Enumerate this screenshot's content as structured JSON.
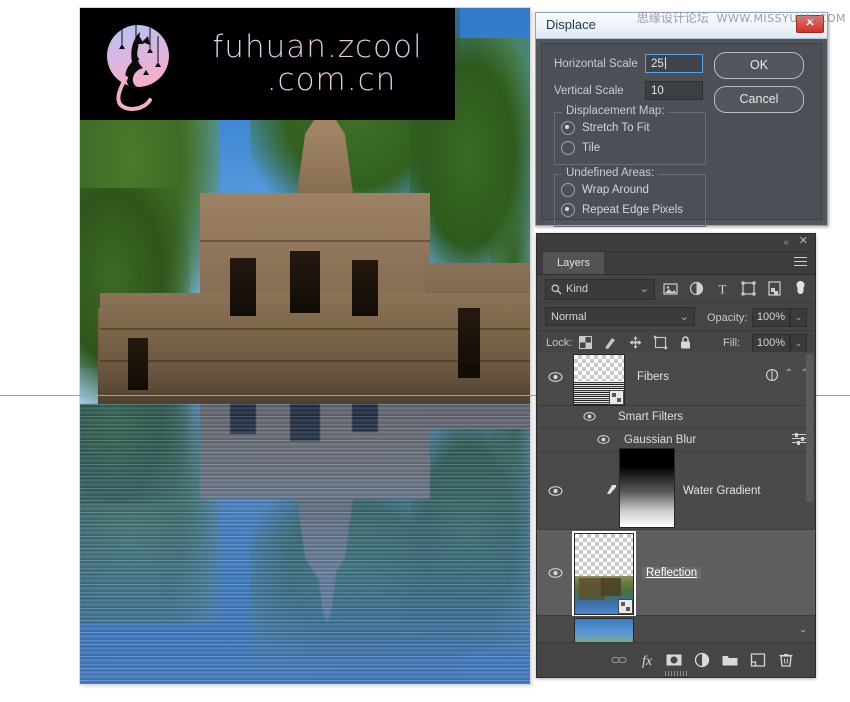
{
  "watermark": {
    "logo_text_line1": "fuhuan.zcool",
    "logo_text_line2": ".com.cn",
    "logo_icon": "cat-logo-icon",
    "forum_cn": "思缘设计论坛",
    "forum_en": "WWW.MISSYUAN.COM"
  },
  "dialog": {
    "title": "Displace",
    "close_label": "✕",
    "fields": [
      {
        "label": "Horizontal Scale",
        "value": "25",
        "focused": true
      },
      {
        "label": "Vertical Scale",
        "value": "10",
        "focused": false
      }
    ],
    "groups": [
      {
        "title": "Displacement Map:",
        "options": [
          {
            "label": "Stretch To Fit",
            "selected": true
          },
          {
            "label": "Tile",
            "selected": false
          }
        ]
      },
      {
        "title": "Undefined Areas:",
        "options": [
          {
            "label": "Wrap Around",
            "selected": false
          },
          {
            "label": "Repeat Edge Pixels",
            "selected": true
          }
        ]
      }
    ],
    "buttons": {
      "ok": "OK",
      "cancel": "Cancel"
    }
  },
  "layers_panel": {
    "tab_label": "Layers",
    "collapse_icon": "double-chevron-icon",
    "close_icon": "close-icon",
    "menu_icon": "panel-menu-icon",
    "filter": {
      "search_icon": "search-icon",
      "kind_label": "Kind",
      "chevron": "⌄",
      "icons": [
        "pixel-filter-icon",
        "adjustment-filter-icon",
        "type-filter-icon",
        "shape-filter-icon",
        "smart-object-filter-icon",
        "filter-toggle-icon"
      ]
    },
    "blend_mode": "Normal",
    "opacity_label": "Opacity:",
    "opacity_value": "100%",
    "lock_label": "Lock:",
    "lock_icons": [
      "lock-transparent-pixels-icon",
      "lock-image-pixels-icon",
      "lock-position-icon",
      "lock-artboard-nesting-icon",
      "lock-all-icon"
    ],
    "fill_label": "Fill:",
    "fill_value": "100%",
    "layers": [
      {
        "name": "Fibers",
        "visible": true,
        "thumb": "fibers-thumbnail",
        "smart_object": true,
        "selected": false,
        "children": [
          {
            "name": "Smart Filters",
            "visible": true,
            "type": "smart-filters-header"
          },
          {
            "name": "Gaussian Blur",
            "visible": true,
            "type": "smart-filter"
          }
        ]
      },
      {
        "name": "Water Gradient",
        "visible": true,
        "thumb": "gradient-thumbnail",
        "smart_object": false,
        "selected": false,
        "children": []
      },
      {
        "name": "Reflection",
        "visible": true,
        "thumb": "reflection-thumbnail",
        "smart_object": true,
        "selected": true,
        "renaming": true,
        "children": []
      },
      {
        "name": "",
        "visible": true,
        "thumb": "background-thumbnail",
        "smart_object": false,
        "selected": false,
        "children": []
      }
    ],
    "bottom_icons": [
      "link-layers-icon",
      "add-layer-style-icon",
      "add-layer-mask-icon",
      "new-adjustment-layer-icon",
      "new-group-icon",
      "new-layer-icon",
      "delete-layer-icon"
    ],
    "bottom_fx_label": "fx"
  },
  "canvas": {
    "guide_color": "#37c7de",
    "description": "Angkor temple photo with mirrored water reflection"
  }
}
